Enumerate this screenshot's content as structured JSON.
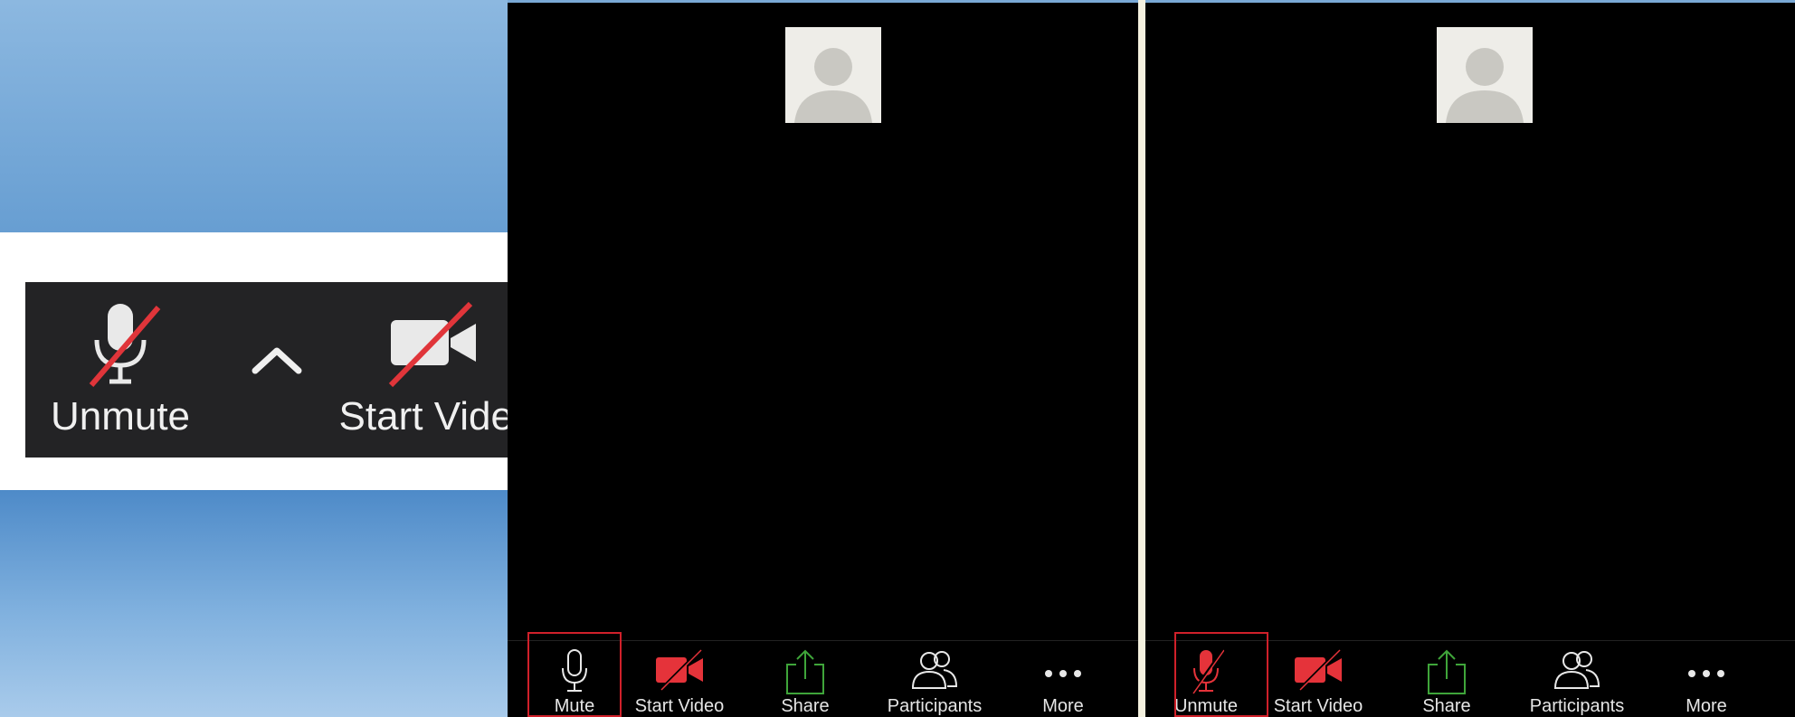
{
  "inset_toolbar": {
    "unmute_label": "Unmute",
    "start_video_label": "Start Video",
    "icons": [
      "microphone-muted-icon",
      "caret-up-icon",
      "video-off-icon",
      "caret-up-icon"
    ]
  },
  "phone_left": {
    "toolbar": {
      "mute_label": "Mute",
      "start_video_label": "Start Video",
      "share_label": "Share",
      "participants_label": "Participants",
      "more_label": "More"
    }
  },
  "phone_right": {
    "toolbar": {
      "unmute_label": "Unmute",
      "start_video_label": "Start Video",
      "share_label": "Share",
      "participants_label": "Participants",
      "more_label": "More"
    }
  },
  "colors": {
    "muted_red": "#e5333a",
    "share_green": "#3fa53a",
    "highlight_red": "#d0202a",
    "toolbar_bg": "#232325"
  }
}
